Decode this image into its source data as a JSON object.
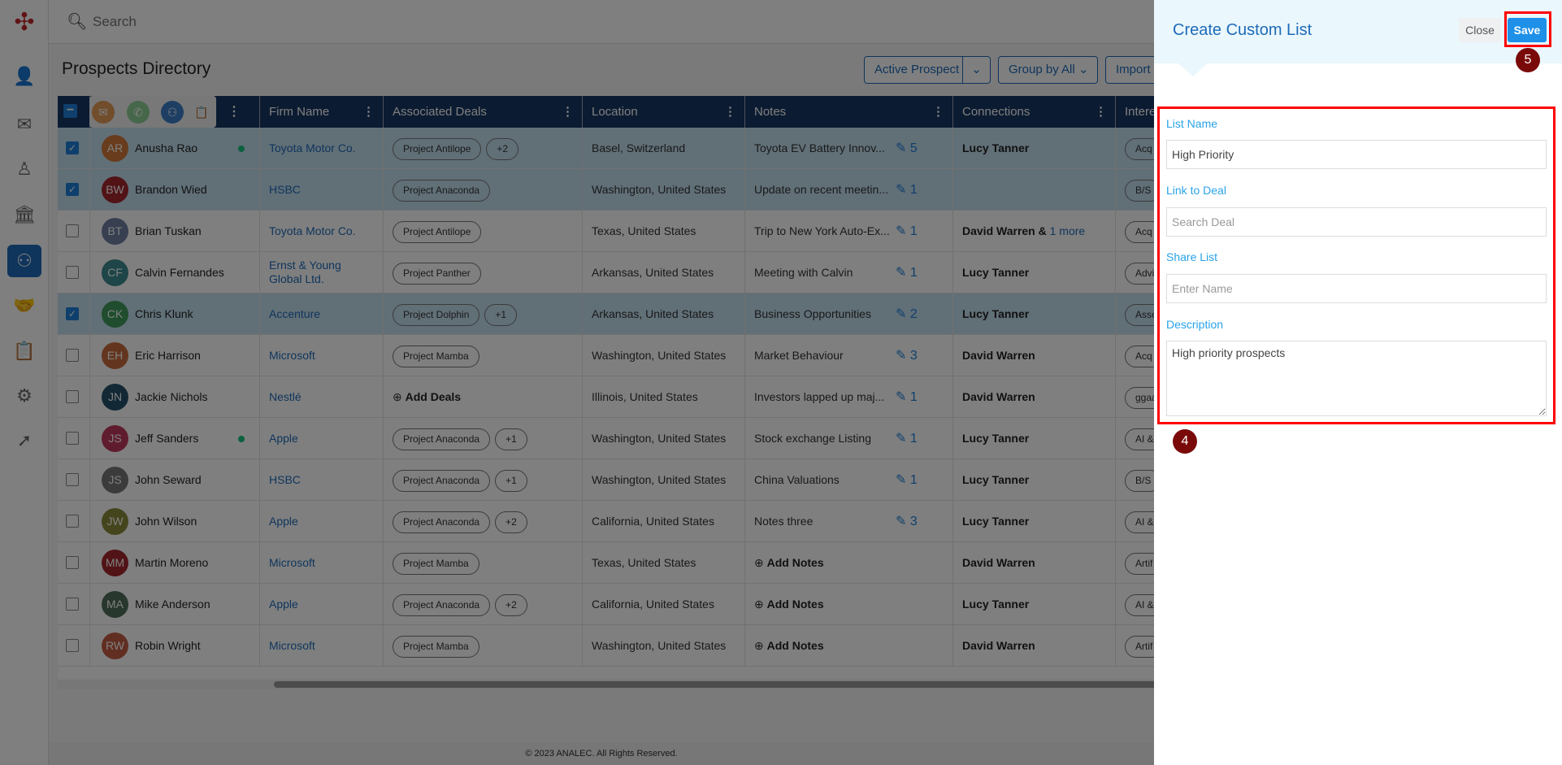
{
  "search": {
    "placeholder": "Search"
  },
  "page": {
    "title": "Prospects Directory"
  },
  "toolbar": {
    "active_prospect": "Active Prospect",
    "group_by": "Group by All",
    "import": "Import"
  },
  "columns": [
    "",
    "Firm Name",
    "Associated Deals",
    "Location",
    "Notes",
    "Connections",
    "Interests"
  ],
  "rows": [
    {
      "initials": "AR",
      "name": "Anusha Rao",
      "color": "#d2793a",
      "online": true,
      "checked": true,
      "firm": "Toyota Motor Co.",
      "deals": [
        "Project Antilope"
      ],
      "more": "+2",
      "location": "Basel, Switzerland",
      "note": "Toyota EV Battery Innov...",
      "note_count": "5",
      "connection": "Lucy Tanner",
      "connection_more": "",
      "interest": "Acq"
    },
    {
      "initials": "BW",
      "name": "Brandon Wied",
      "color": "#a3262c",
      "online": false,
      "checked": true,
      "firm": "HSBC",
      "deals": [
        "Project Anaconda"
      ],
      "more": "",
      "location": "Washington, United States",
      "note": "Update on recent meetin...",
      "note_count": "1",
      "connection": "",
      "connection_more": "",
      "interest": "B/S"
    },
    {
      "initials": "BT",
      "name": "Brian Tuskan",
      "color": "#6f7ea3",
      "online": false,
      "checked": false,
      "firm": "Toyota Motor Co.",
      "deals": [
        "Project Antilope"
      ],
      "more": "",
      "location": "Texas, United States",
      "note": "Trip to New York Auto-Ex...",
      "note_count": "1",
      "connection": "David Warren",
      "connection_more": "1 more",
      "interest": "Acq"
    },
    {
      "initials": "CF",
      "name": "Calvin Fernandes",
      "color": "#3d8b8f",
      "online": false,
      "checked": false,
      "firm": "Ernst & Young Global Ltd.",
      "deals": [
        "Project Panther"
      ],
      "more": "",
      "location": "Arkansas, United States",
      "note": "Meeting with Calvin",
      "note_count": "1",
      "connection": "Lucy Tanner",
      "connection_more": "",
      "interest": "Advi"
    },
    {
      "initials": "CK",
      "name": "Chris Klunk",
      "color": "#3f9a5a",
      "online": false,
      "checked": true,
      "firm": "Accenture",
      "deals": [
        "Project Dolphin"
      ],
      "more": "+1",
      "location": "Arkansas, United States",
      "note": "Business Opportunities",
      "note_count": "2",
      "connection": "Lucy Tanner",
      "connection_more": "",
      "interest": "Asse"
    },
    {
      "initials": "EH",
      "name": "Eric Harrison",
      "color": "#c86a3d",
      "online": false,
      "checked": false,
      "firm": "Microsoft",
      "deals": [
        "Project Mamba"
      ],
      "more": "",
      "location": "Washington, United States",
      "note": "Market Behaviour",
      "note_count": "3",
      "connection": "David Warren",
      "connection_more": "",
      "interest": "Acq"
    },
    {
      "initials": "JN",
      "name": "Jackie Nichols",
      "color": "#24516a",
      "online": false,
      "checked": false,
      "firm": "Nestlé",
      "deals": [],
      "add_deals": "Add Deals",
      "more": "",
      "location": "Illinois, United States",
      "note": "Investors lapped up maj...",
      "note_count": "1",
      "connection": "David Warren",
      "connection_more": "",
      "interest": "ggaa"
    },
    {
      "initials": "JS",
      "name": "Jeff Sanders",
      "color": "#c0395e",
      "online": true,
      "checked": false,
      "firm": "Apple",
      "deals": [
        "Project Anaconda"
      ],
      "more": "+1",
      "location": "Washington, United States",
      "note": "Stock exchange Listing",
      "note_count": "1",
      "connection": "Lucy Tanner",
      "connection_more": "",
      "interest": "AI &"
    },
    {
      "initials": "JS",
      "name": "John Seward",
      "color": "#777777",
      "online": false,
      "checked": false,
      "firm": "HSBC",
      "deals": [
        "Project Anaconda"
      ],
      "more": "+1",
      "location": "Washington, United States",
      "note": "China Valuations",
      "note_count": "1",
      "connection": "Lucy Tanner",
      "connection_more": "",
      "interest": "B/S"
    },
    {
      "initials": "JW",
      "name": "John Wilson",
      "color": "#8a8a3a",
      "online": false,
      "checked": false,
      "firm": "Apple",
      "deals": [
        "Project Anaconda"
      ],
      "more": "+2",
      "location": "California, United States",
      "note": "Notes three",
      "note_count": "3",
      "connection": "Lucy Tanner",
      "connection_more": "",
      "interest": "AI &"
    },
    {
      "initials": "MM",
      "name": "Martin Moreno",
      "color": "#a3262c",
      "online": false,
      "checked": false,
      "firm": "Microsoft",
      "deals": [
        "Project Mamba"
      ],
      "more": "",
      "location": "Texas, United States",
      "add_notes": "Add Notes",
      "connection": "David Warren",
      "connection_more": "",
      "interest": "Artif"
    },
    {
      "initials": "MA",
      "name": "Mike Anderson",
      "color": "#4f6e5a",
      "online": false,
      "checked": false,
      "firm": "Apple",
      "deals": [
        "Project Anaconda"
      ],
      "more": "+2",
      "location": "California, United States",
      "add_notes": "Add Notes",
      "connection": "Lucy Tanner",
      "connection_more": "",
      "interest": "AI &"
    },
    {
      "initials": "RW",
      "name": "Robin Wright",
      "color": "#c45c45",
      "online": false,
      "checked": false,
      "firm": "Microsoft",
      "deals": [
        "Project Mamba"
      ],
      "more": "",
      "location": "Washington, United States",
      "add_notes": "Add Notes",
      "connection": "David Warren",
      "connection_more": "",
      "interest": "Artif"
    }
  ],
  "footer": {
    "text": "© 2023 ANALEC. All Rights Reserved."
  },
  "panel": {
    "title": "Create Custom List",
    "close": "Close",
    "save": "Save",
    "list_name_label": "List Name",
    "list_name_value": "High Priority",
    "link_deal_label": "Link to Deal",
    "link_deal_placeholder": "Search Deal",
    "share_label": "Share List",
    "share_placeholder": "Enter Name",
    "description_label": "Description",
    "description_value": "High priority prospects"
  },
  "annotations": {
    "form_step": "4",
    "save_step": "5"
  },
  "colors": {
    "accent": "#1e6bb8",
    "header": "#163663",
    "highlight": "#ff0000",
    "badge": "#7a0a0a"
  }
}
